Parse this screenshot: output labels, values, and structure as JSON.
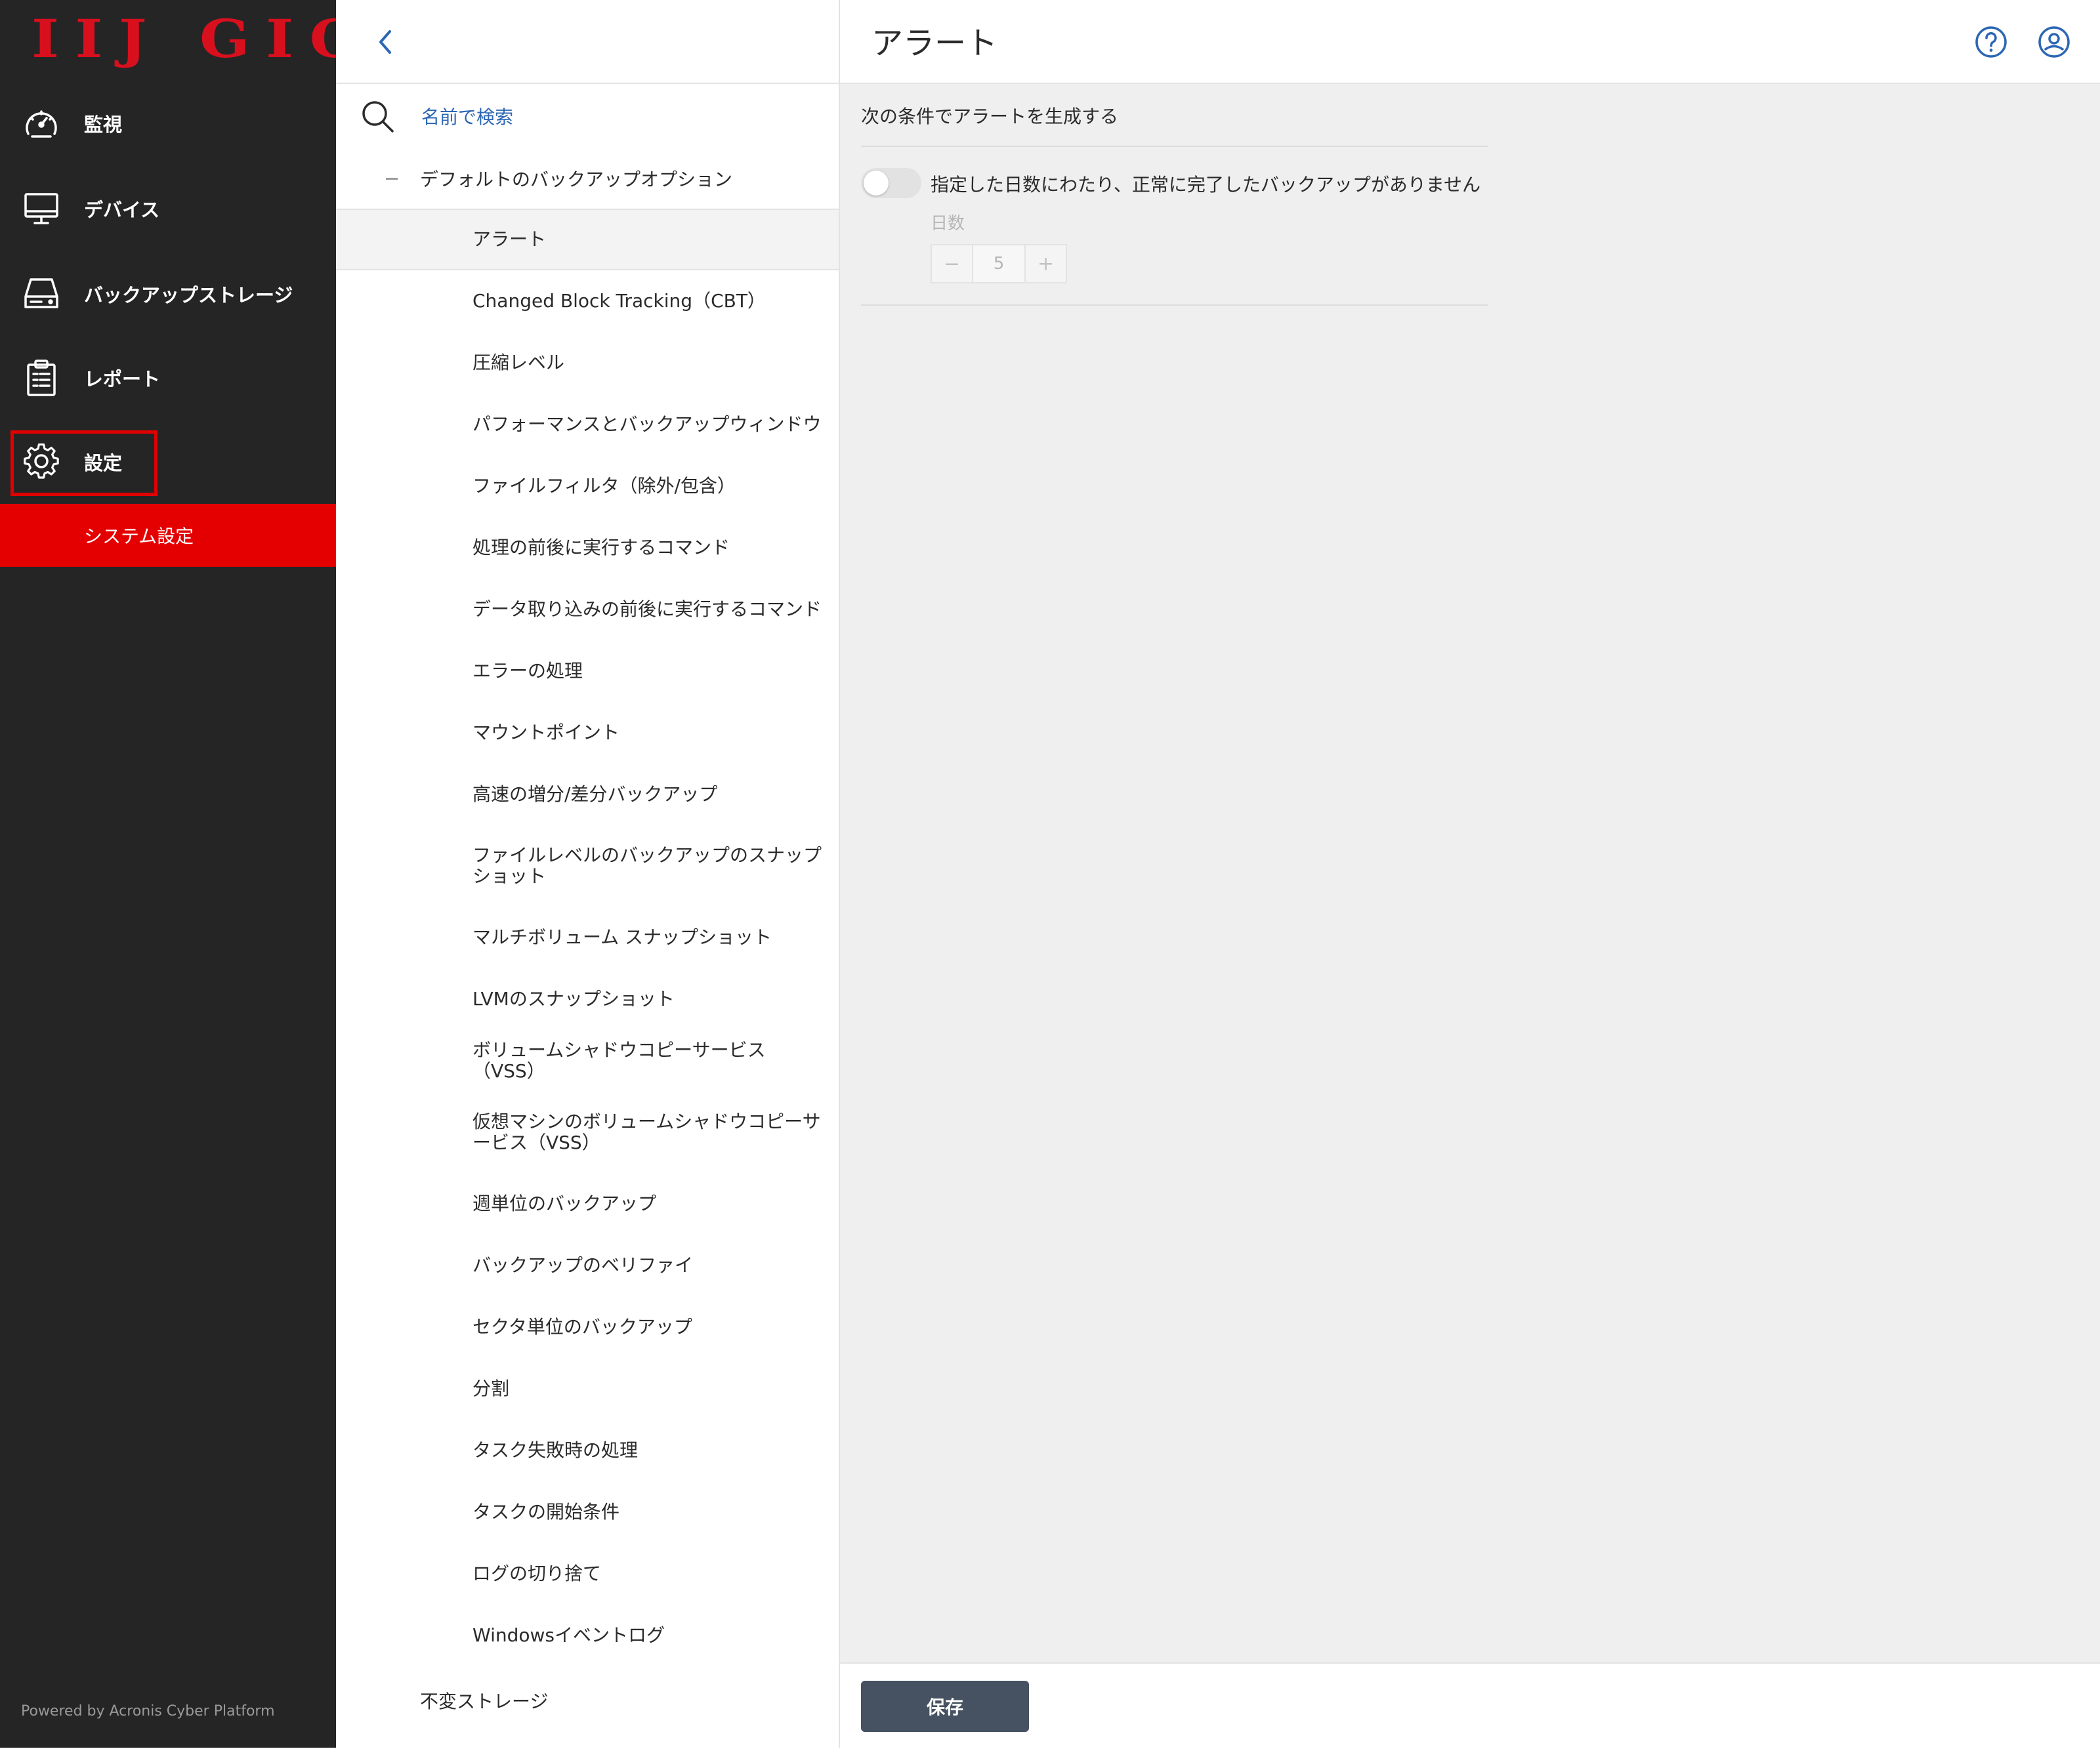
{
  "brand": {
    "logo_text": "IIJ GIO",
    "powered_by": "Powered by Acronis Cyber Platform",
    "accent_color": "#e40000",
    "logo_color": "#d8101e"
  },
  "sidebar": {
    "items": [
      {
        "label": "監視",
        "icon": "dashboard-gauge-icon"
      },
      {
        "label": "デバイス",
        "icon": "monitor-icon"
      },
      {
        "label": "バックアップストレージ",
        "icon": "storage-drive-icon"
      },
      {
        "label": "レポート",
        "icon": "clipboard-report-icon"
      },
      {
        "label": "設定",
        "icon": "gear-icon",
        "highlighted": true
      }
    ],
    "sub_item": {
      "label": "システム設定",
      "active": true
    }
  },
  "tree": {
    "search_placeholder": "名前で検索",
    "group_label": "デフォルトのバックアップオプション",
    "items": [
      "アラート",
      "Changed Block Tracking（CBT）",
      "圧縮レベル",
      "パフォーマンスとバックアップウィンドウ",
      "ファイルフィルタ（除外/包含）",
      "処理の前後に実行するコマンド",
      "データ取り込みの前後に実行するコマンド",
      "エラーの処理",
      "マウントポイント",
      "高速の増分/差分バックアップ",
      "ファイルレベルのバックアップのスナップショット",
      "マルチボリューム スナップショット",
      "LVMのスナップショット",
      "ボリュームシャドウコピーサービス（VSS）",
      "仮想マシンのボリュームシャドウコピーサービス（VSS）",
      "週単位のバックアップ",
      "バックアップのベリファイ",
      "セクタ単位のバックアップ",
      "分割",
      "タスク失敗時の処理",
      "タスクの開始条件",
      "ログの切り捨て",
      "Windowsイベントログ"
    ],
    "selected_item": "アラート",
    "bottom_group": "不変ストレージ"
  },
  "content": {
    "title": "アラート",
    "section_label": "次の条件でアラートを生成する",
    "toggle": {
      "label": "指定した日数にわたり、正常に完了したバックアップがありません",
      "enabled": false
    },
    "days_label": "日数",
    "days_value": "5",
    "minus_label": "−",
    "plus_label": "+",
    "save_label": "保存"
  },
  "header_icons": [
    "help-icon",
    "account-icon"
  ]
}
